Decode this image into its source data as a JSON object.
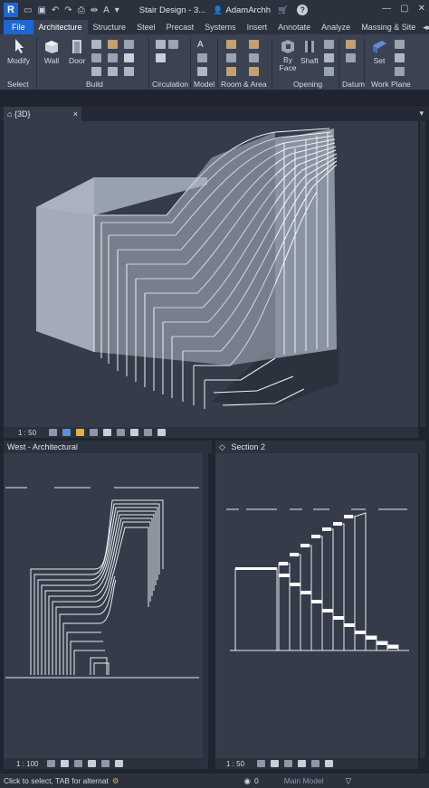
{
  "titlebar": {
    "logo": "R",
    "title": "Stair Design - 3...",
    "user": "AdamArchh",
    "help": "?"
  },
  "tabs": [
    "File",
    "Architecture",
    "Structure",
    "Steel",
    "Precast",
    "Systems",
    "Insert",
    "Annotate",
    "Analyze",
    "Massing & Site"
  ],
  "ribbon": {
    "modify": "Modify",
    "wall": "Wall",
    "door": "Door",
    "by_face": "By Face",
    "shaft": "Shaft",
    "set": "Set",
    "groups": {
      "select": "Select",
      "build": "Build",
      "circulation": "Circulation",
      "model": "Model",
      "room_area": "Room & Area",
      "opening": "Opening",
      "datum": "Datum",
      "work_plane": "Work Plane"
    }
  },
  "view_tab": {
    "label": "{3D}",
    "close": "×"
  },
  "view3d": {
    "scale": "1 : 50"
  },
  "west": {
    "title": "West - Architectural",
    "scale": "1 : 100"
  },
  "section": {
    "title": "Section 2",
    "scale": "1 : 50"
  },
  "status": {
    "text": "Click to select, TAB for alternat",
    "model": "Main Model",
    "zero": "0"
  },
  "colors": {
    "file_tab": "#1d66d4",
    "canvas": "#353b48",
    "chrome": "#2b313d",
    "ribbon": "#3b4252"
  }
}
